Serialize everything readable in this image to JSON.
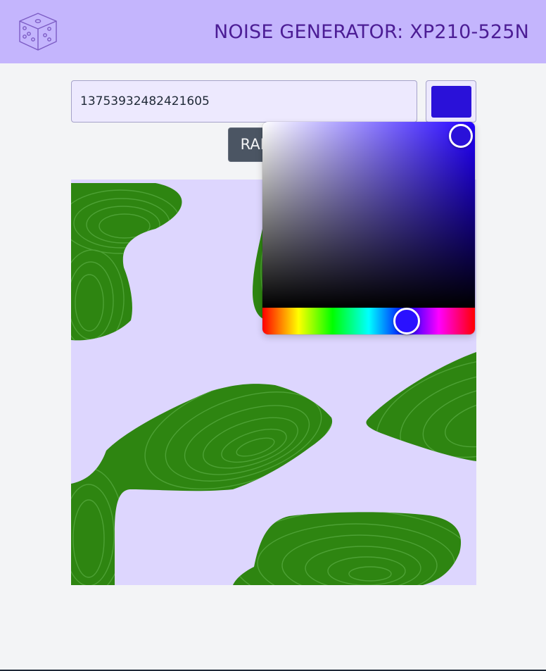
{
  "header": {
    "title": "NOISE GENERATOR: XP210-525N",
    "logo_icon": "dice-icon",
    "background_color": "#c4b5fd",
    "title_color": "#4c1d95"
  },
  "controls": {
    "seed_value": "13753932482421605",
    "random_label": "RANDOM",
    "selected_color": "#2a11d9"
  },
  "color_picker": {
    "hue_color": "#2200ff",
    "pointer_icon": "saturation-handle-icon",
    "hue_pointer_icon": "hue-handle-icon"
  },
  "noise_map": {
    "land_color": "#2e8511",
    "contour_color": "#4f9a38",
    "water_color": "#ddd6fe"
  }
}
